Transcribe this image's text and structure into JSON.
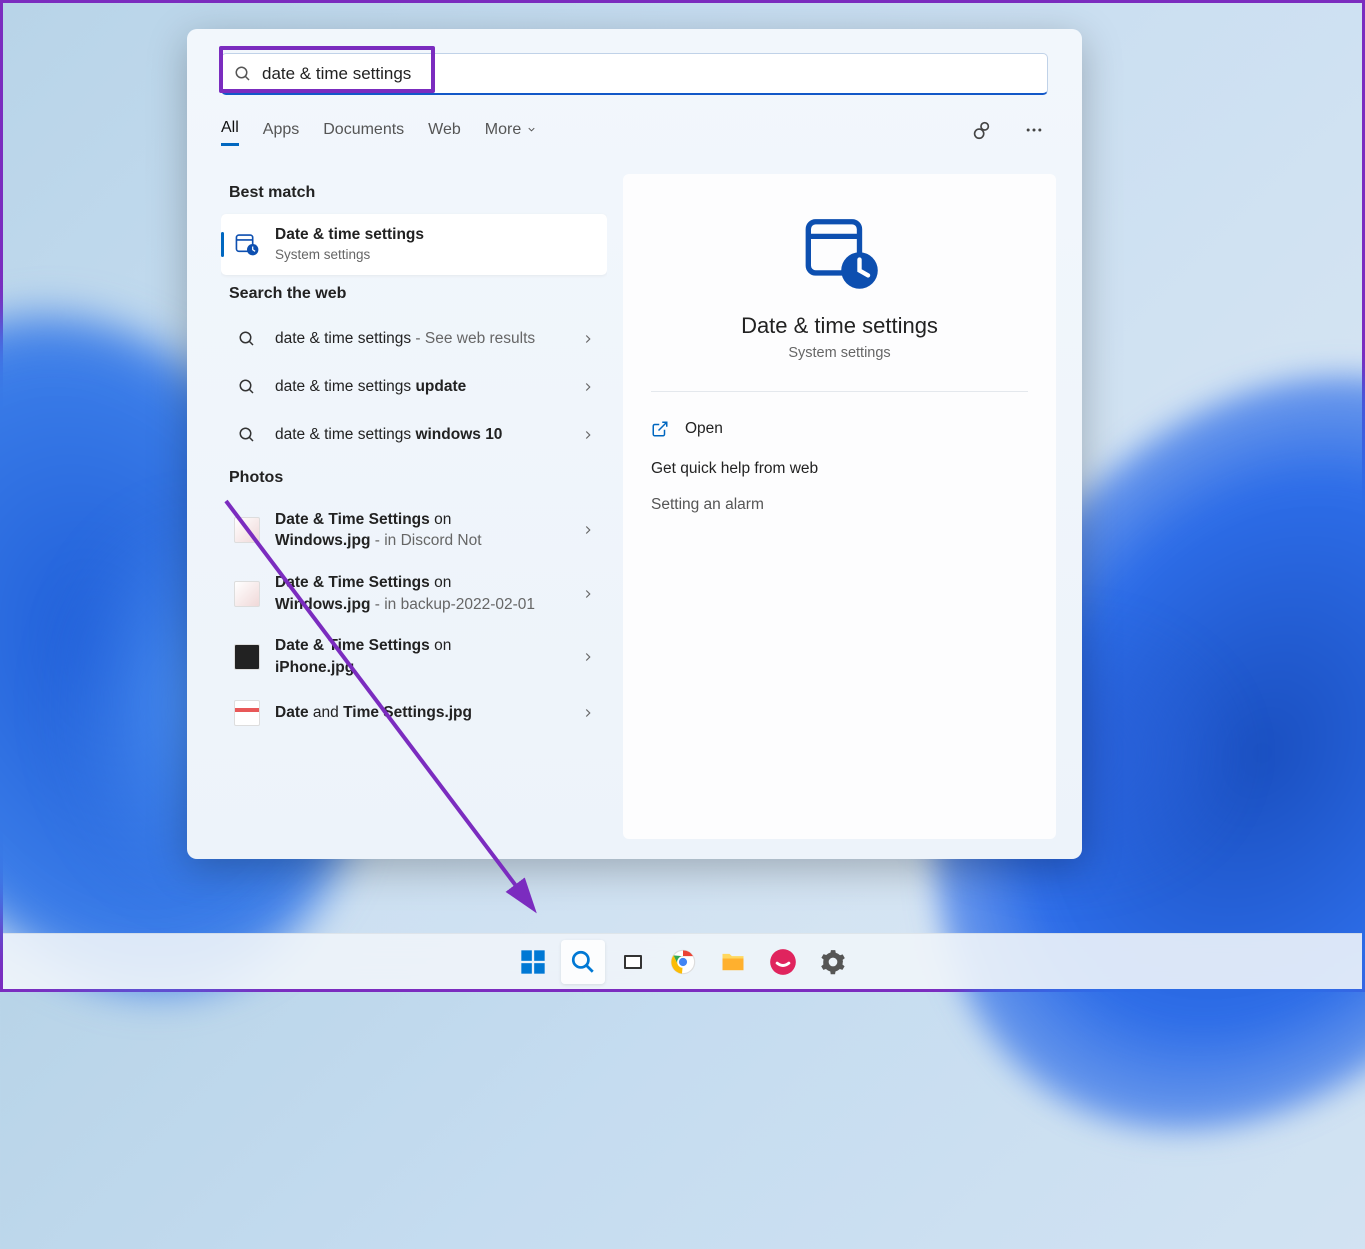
{
  "search": {
    "value": "date & time settings"
  },
  "tabs": {
    "all": "All",
    "apps": "Apps",
    "documents": "Documents",
    "web": "Web",
    "more": "More"
  },
  "sections": {
    "best_match": "Best match",
    "search_web": "Search the web",
    "photos": "Photos"
  },
  "best": {
    "title": "Date & time settings",
    "sub": "System settings"
  },
  "web": {
    "item1_prefix": "date & time settings",
    "item1_suffix": " - See web results",
    "item2_prefix": "date & time settings ",
    "item2_bold": "update",
    "item3_prefix": "date & time settings ",
    "item3_bold": "windows 10"
  },
  "photos": {
    "p1_b1": "Date & Time Settings",
    "p1_t1": " on ",
    "p1_b2": "Windows.jpg",
    "p1_t2": " - in Discord Not",
    "p2_b1": "Date & Time Settings",
    "p2_t1": " on ",
    "p2_b2": "Windows.jpg",
    "p2_t2": " - in backup-2022-02-01",
    "p3_b1": "Date & Time Settings",
    "p3_t1": " on ",
    "p3_b2": "iPhone.jpg",
    "p4_b1": "Date",
    "p4_t1": " and ",
    "p4_b2": "Time Settings.jpg"
  },
  "detail": {
    "title": "Date & time settings",
    "sub": "System settings",
    "open": "Open",
    "help": "Get quick help from web",
    "link1": "Setting an alarm"
  }
}
